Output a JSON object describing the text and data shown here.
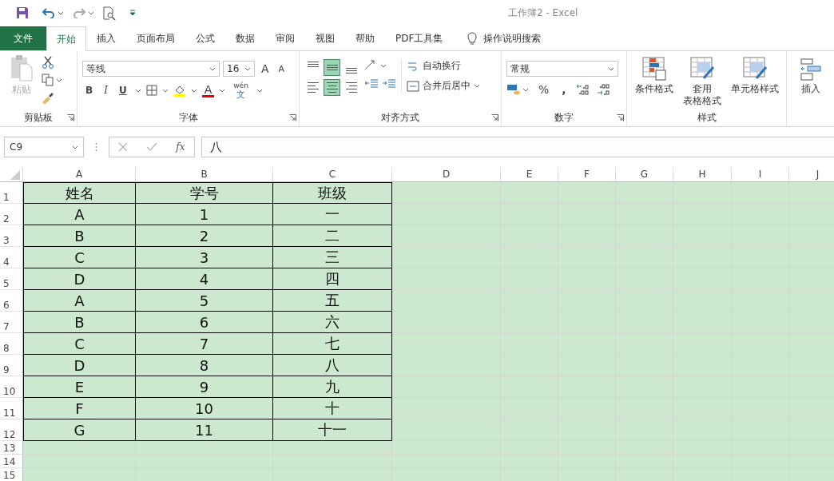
{
  "window": {
    "title": "工作簿2 - Excel"
  },
  "tabs": [
    {
      "label": "文件",
      "kind": "file",
      "selected": false
    },
    {
      "label": "开始",
      "kind": "tab",
      "selected": true
    },
    {
      "label": "插入",
      "kind": "tab",
      "selected": false
    },
    {
      "label": "页面布局",
      "kind": "tab",
      "selected": false
    },
    {
      "label": "公式",
      "kind": "tab",
      "selected": false
    },
    {
      "label": "数据",
      "kind": "tab",
      "selected": false
    },
    {
      "label": "审阅",
      "kind": "tab",
      "selected": false
    },
    {
      "label": "视图",
      "kind": "tab",
      "selected": false
    },
    {
      "label": "帮助",
      "kind": "tab",
      "selected": false
    },
    {
      "label": "PDF工具集",
      "kind": "tab",
      "selected": false
    }
  ],
  "tell_me": "操作说明搜索",
  "ribbon": {
    "clipboard": {
      "paste": "粘贴",
      "label": "剪贴板"
    },
    "font": {
      "name": "等线",
      "size": "16",
      "grow": "A",
      "shrink": "A",
      "bold": "B",
      "italic": "I",
      "underline": "U",
      "font_color": "A",
      "phonetic_top": "wén",
      "phonetic_bottom": "文",
      "label": "字体"
    },
    "alignment": {
      "buttons": [
        {
          "kind": "top",
          "selected": false
        },
        {
          "kind": "middle",
          "selected": true
        },
        {
          "kind": "bottom",
          "selected": false
        },
        {
          "kind": "left",
          "selected": false
        },
        {
          "kind": "center",
          "selected": true
        },
        {
          "kind": "right",
          "selected": false
        }
      ],
      "wrap": "自动换行",
      "merge": "合并后居中",
      "label": "对齐方式"
    },
    "number": {
      "format": "常规",
      "percent": "%",
      "comma": ",",
      "label": "数字"
    },
    "styles": {
      "buttons": [
        {
          "lines": [
            "条件格式"
          ]
        },
        {
          "lines": [
            "套用",
            "表格格式"
          ]
        },
        {
          "lines": [
            "单元格样式"
          ]
        }
      ],
      "label": "样式"
    },
    "cells": {
      "insert": "插入"
    }
  },
  "formula_bar": {
    "name_box": "C9",
    "fx": "fx",
    "value": "八"
  },
  "sheet": {
    "columns": [
      "A",
      "B",
      "C",
      "D",
      "E",
      "F",
      "G",
      "H",
      "I",
      "J"
    ],
    "rows": [
      {
        "number": "1",
        "cells": [
          "姓名",
          "学号",
          "班级"
        ]
      },
      {
        "number": "2",
        "cells": [
          "A",
          "1",
          "一"
        ]
      },
      {
        "number": "3",
        "cells": [
          "B",
          "2",
          "二"
        ]
      },
      {
        "number": "4",
        "cells": [
          "C",
          "3",
          "三"
        ]
      },
      {
        "number": "5",
        "cells": [
          "D",
          "4",
          "四"
        ]
      },
      {
        "number": "6",
        "cells": [
          "A",
          "5",
          "五"
        ]
      },
      {
        "number": "7",
        "cells": [
          "B",
          "6",
          "六"
        ]
      },
      {
        "number": "8",
        "cells": [
          "C",
          "7",
          "七"
        ]
      },
      {
        "number": "9",
        "cells": [
          "D",
          "8",
          "八"
        ]
      },
      {
        "number": "10",
        "cells": [
          "E",
          "9",
          "九"
        ]
      },
      {
        "number": "11",
        "cells": [
          "F",
          "10",
          "十"
        ]
      },
      {
        "number": "12",
        "cells": [
          "G",
          "11",
          "十一"
        ]
      },
      {
        "number": "13"
      },
      {
        "number": "14"
      },
      {
        "number": "15"
      }
    ]
  }
}
